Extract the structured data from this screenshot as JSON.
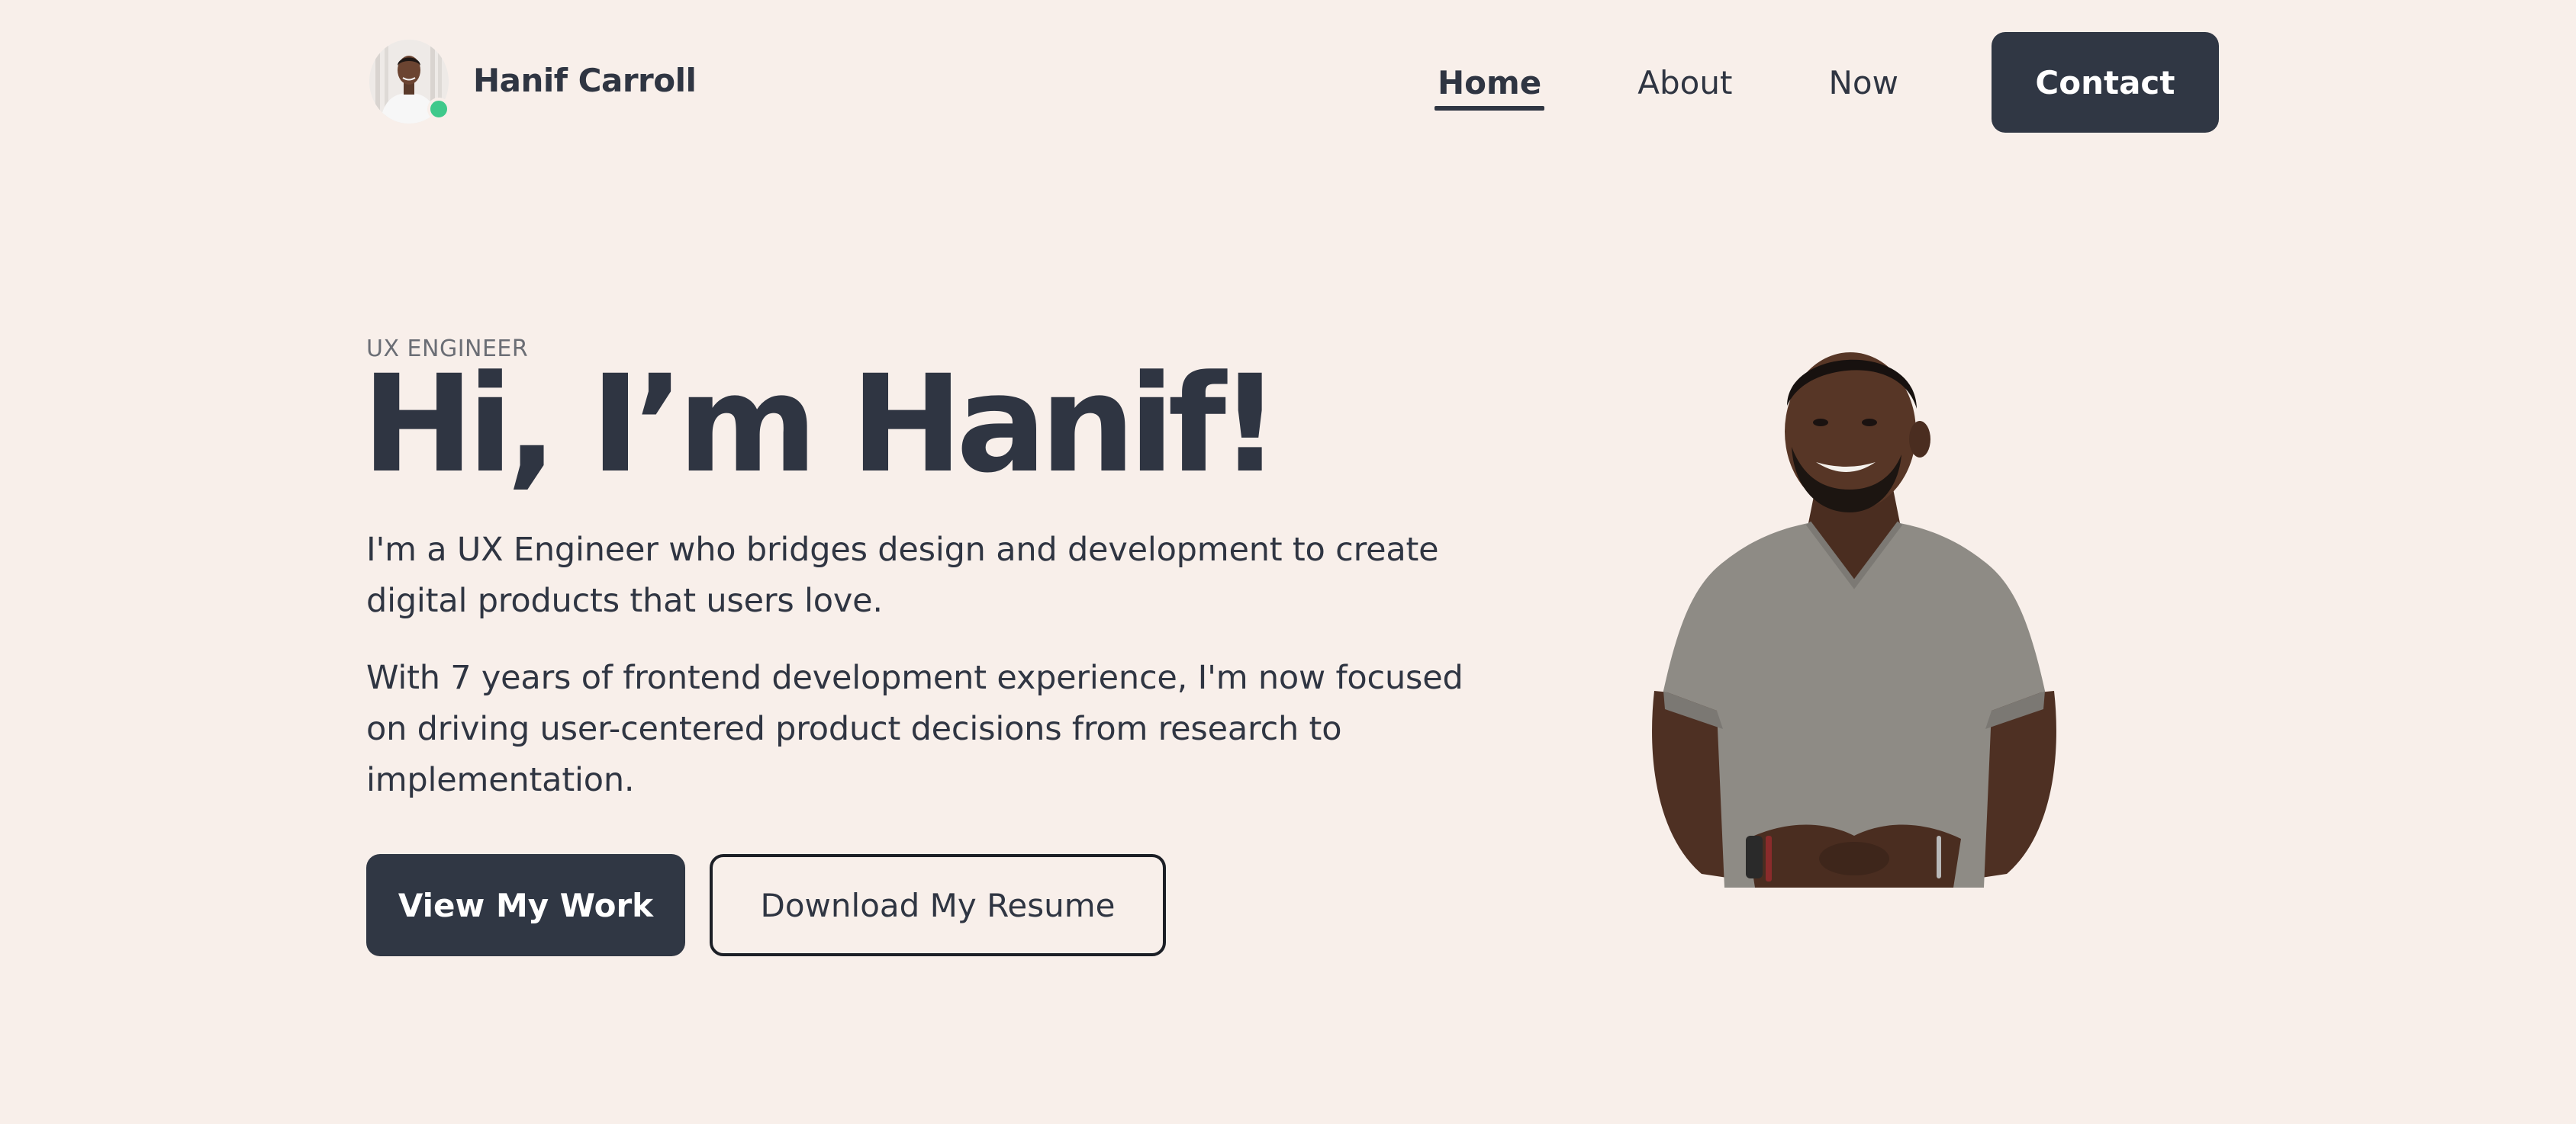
{
  "header": {
    "brand_name": "Hanif Carroll",
    "nav": {
      "home": "Home",
      "about": "About",
      "now": "Now",
      "contact": "Contact"
    },
    "active_item": "Home"
  },
  "hero": {
    "eyebrow": "UX ENGINEER",
    "title": "Hi, I’m Hanif!",
    "paragraph_1": "I'm a UX Engineer who bridges design and development to create digital products that users love.",
    "paragraph_2": "With 7 years of frontend development experience, I'm now focused on driving user-centered product decisions from research to implementation.",
    "primary_button": "View My Work",
    "secondary_button": "Download My Resume"
  },
  "icons": {
    "avatar": "avatar-photo",
    "status": "online-status-dot"
  },
  "colors": {
    "background": "#f8efea",
    "text": "#2f3542",
    "button_dark": "#303744",
    "status_green": "#3fc98b"
  }
}
